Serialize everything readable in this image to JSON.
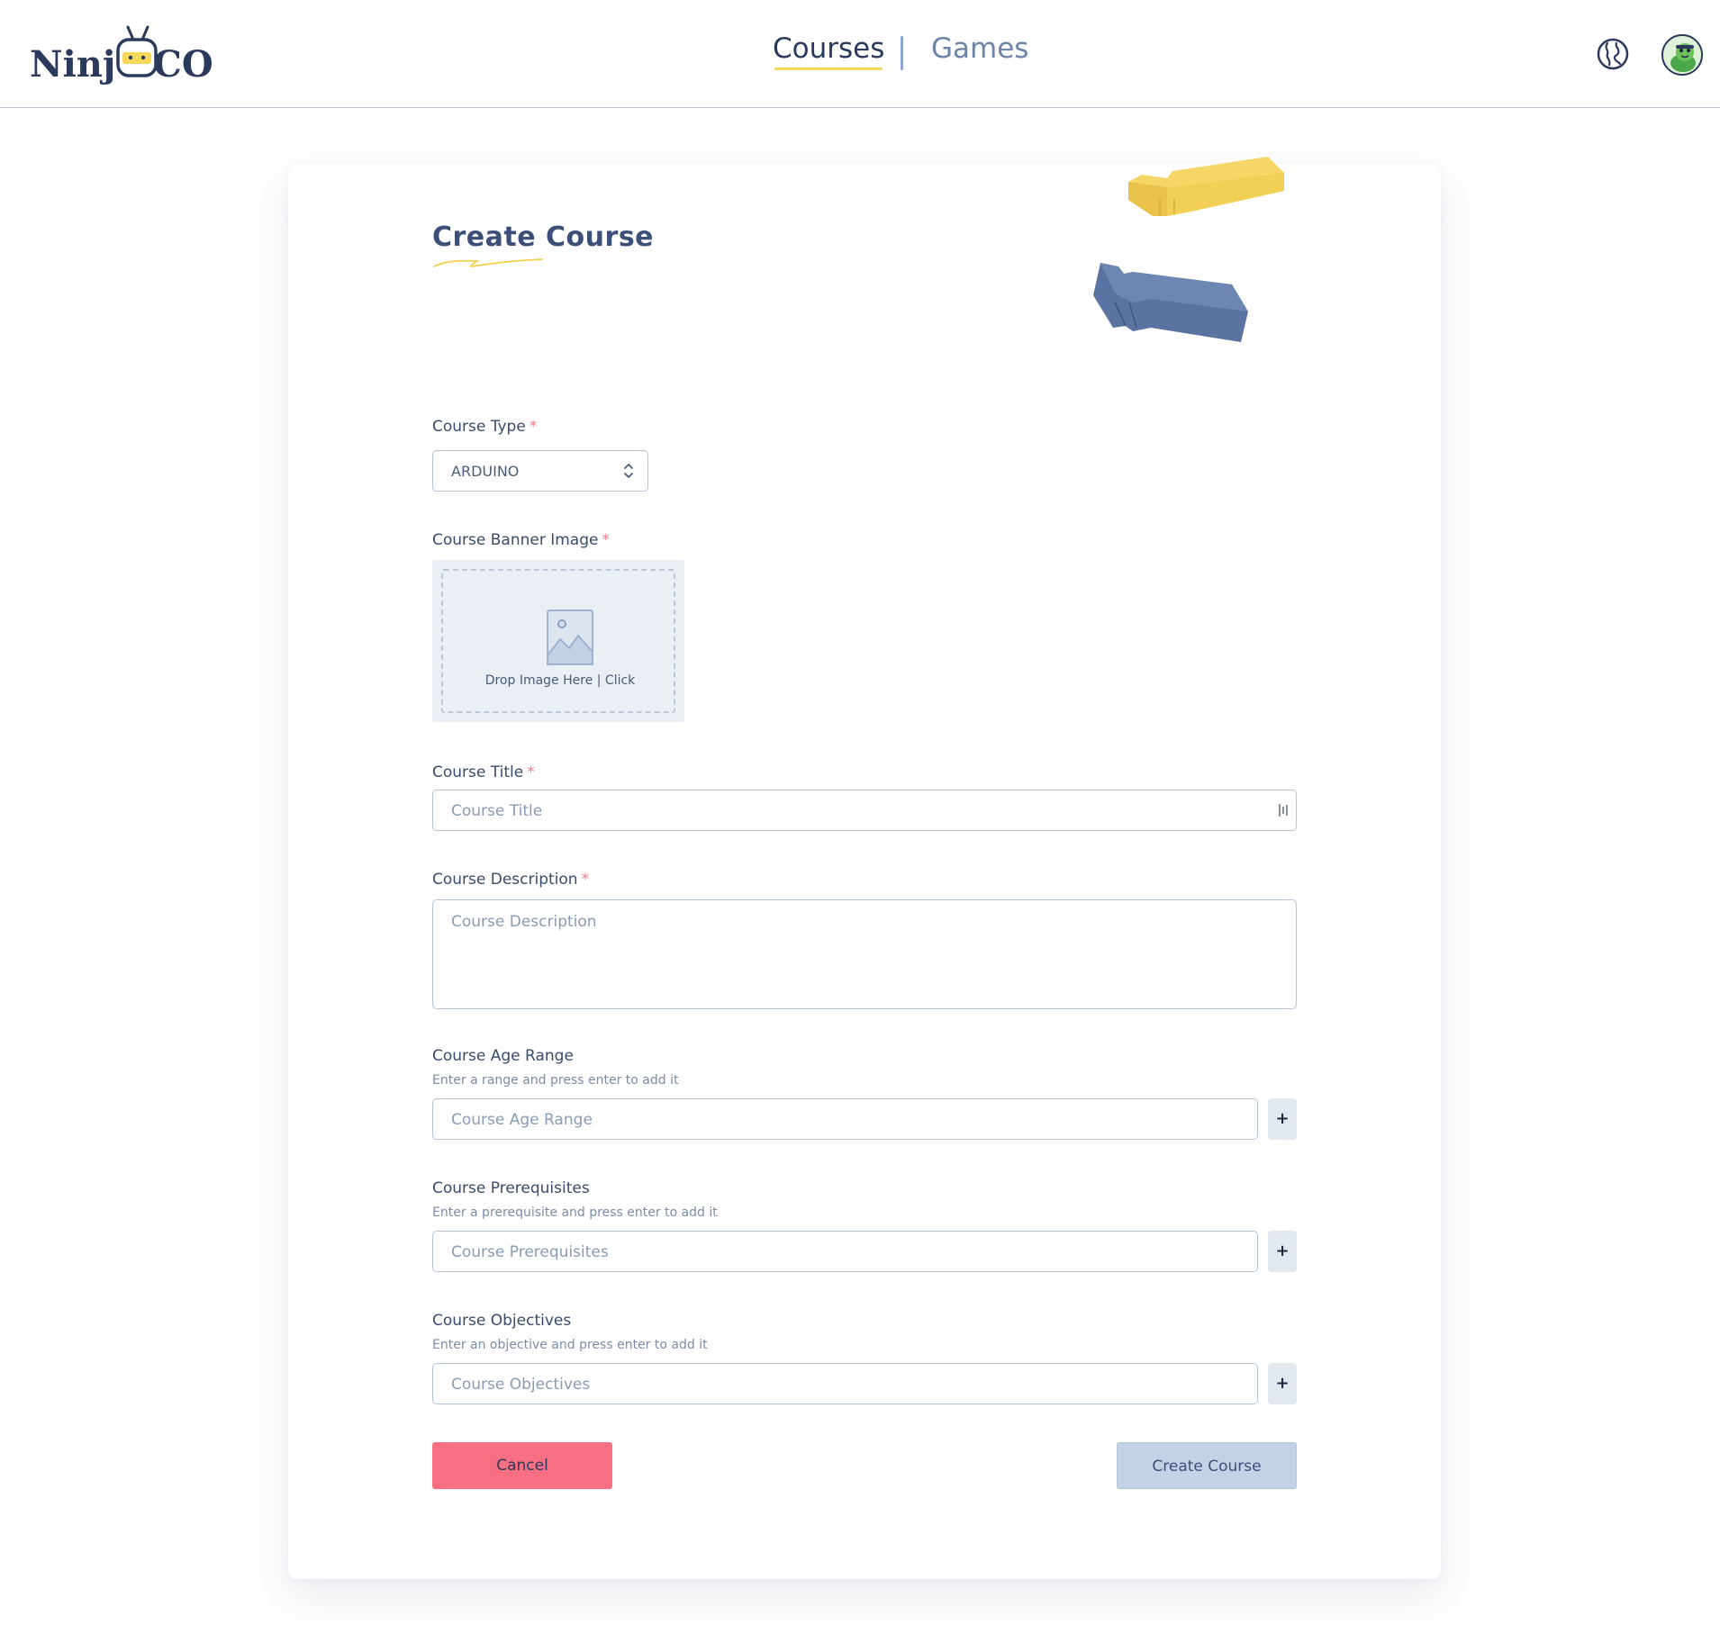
{
  "header": {
    "logo": {
      "left": "Ninj",
      "right": "CO"
    },
    "nav": [
      {
        "label": "Courses",
        "active": true
      },
      {
        "label": "Games",
        "active": false
      }
    ],
    "icons": [
      "globe-icon",
      "user-avatar"
    ]
  },
  "page": {
    "title": "Create Course"
  },
  "form": {
    "course_type": {
      "label": "Course Type",
      "required": "*",
      "value": "ARDUINO"
    },
    "banner_image": {
      "label": "Course Banner Image",
      "required": "*",
      "drop_text": "Drop Image Here | Click"
    },
    "course_title": {
      "label": "Course Title",
      "required": "*",
      "placeholder": "Course Title"
    },
    "course_description": {
      "label": "Course Description",
      "required": "*",
      "placeholder": "Course Description"
    },
    "age_range": {
      "label": "Course Age Range",
      "hint": "Enter a range and press enter to add it",
      "placeholder": "Course Age Range",
      "add_label": "+"
    },
    "prerequisites": {
      "label": "Course Prerequisites",
      "hint": "Enter a prerequisite and press enter to add it",
      "placeholder": "Course Prerequisites",
      "add_label": "+"
    },
    "objectives": {
      "label": "Course Objectives",
      "hint": "Enter an objective and press enter to add it",
      "placeholder": "Course Objectives",
      "add_label": "+"
    }
  },
  "actions": {
    "cancel": "Cancel",
    "create": "Create Course"
  },
  "colors": {
    "accent_yellow": "#f7d85a",
    "navy": "#2b3a5c",
    "cancel_red": "#f76f82",
    "create_blue": "#c3d2e4",
    "brick_blue": "#5b73a0"
  }
}
